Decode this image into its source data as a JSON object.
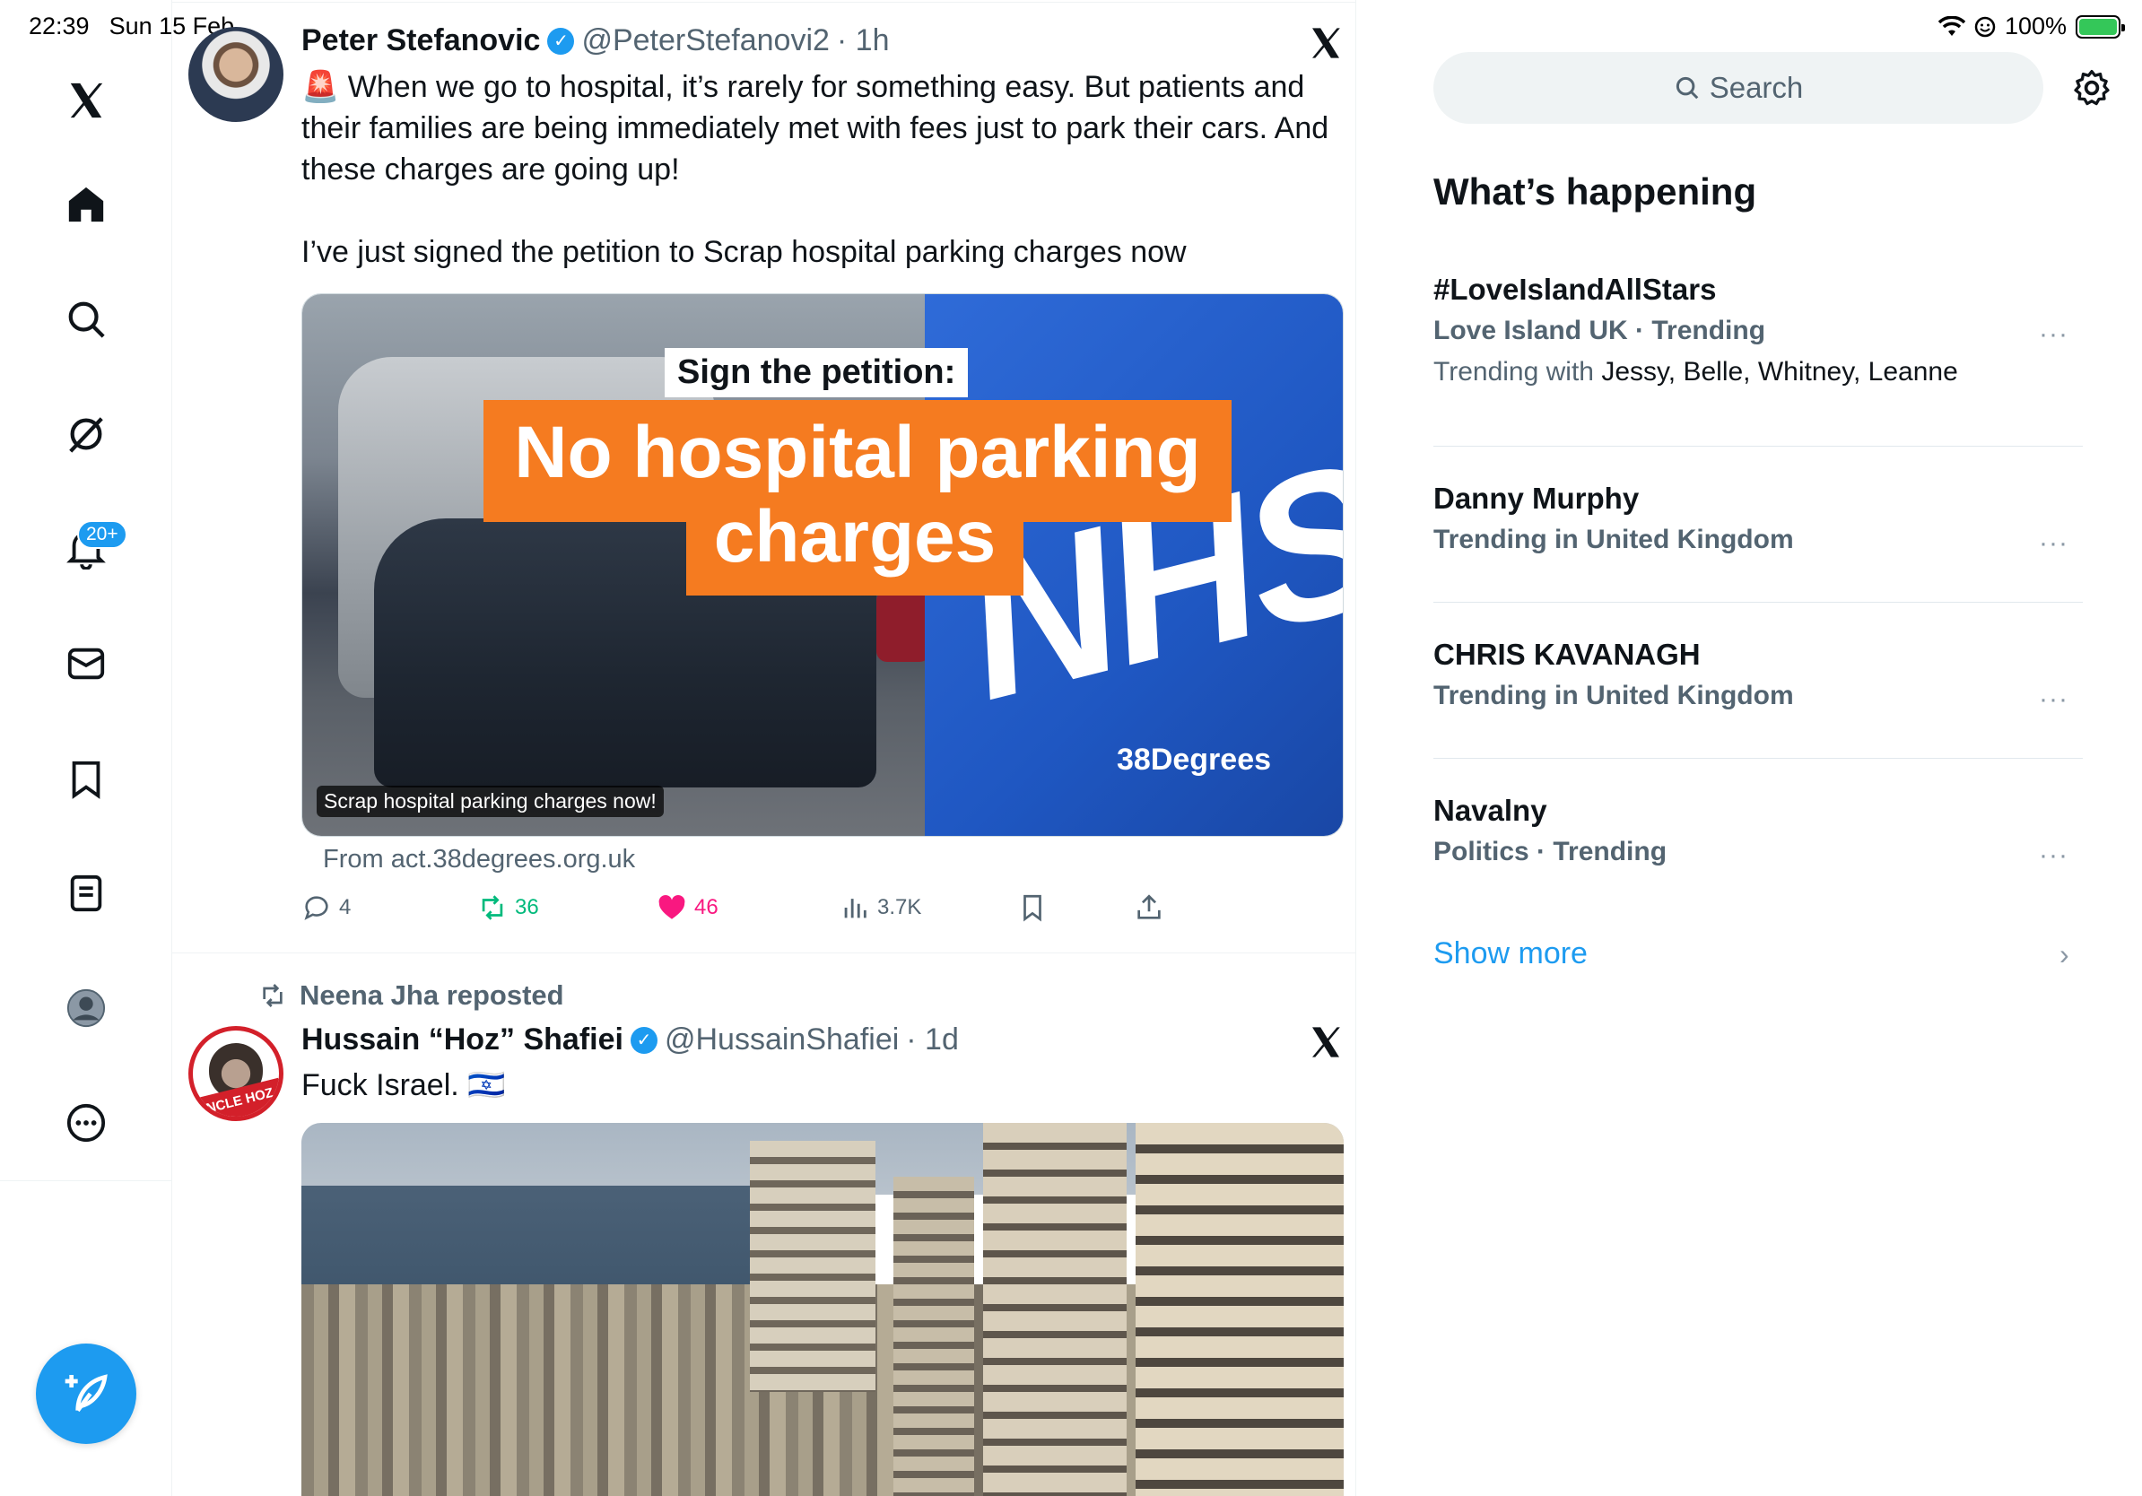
{
  "status_bar": {
    "time": "22:39",
    "date": "Sun 15 Feb",
    "battery": "100%"
  },
  "nav": {
    "items": [
      "x-logo",
      "home",
      "explore",
      "grok",
      "notifications",
      "messages",
      "bookmarks",
      "lists",
      "profile",
      "more"
    ],
    "notification_badge": "20+"
  },
  "tweet1": {
    "name": "Peter Stefanovic",
    "handle": "@PeterStefanovi2",
    "time": "· 1h",
    "text_line1": "🚨 When we go to hospital, it’s rarely for something easy. But patients and",
    "text_line2": "their families are being immediately met with fees just to park their cars. And",
    "text_line3": "these charges are going up!",
    "text_line4": "I’ve just signed the petition to Scrap hospital parking charges now",
    "media": {
      "sign_text": "Sign the petition:",
      "title_line1": "No hospital parking",
      "title_line2": "charges",
      "nhs": "NHS",
      "brand": "38Degrees",
      "caption": "Scrap hospital parking charges now!"
    },
    "link_from": "From act.38degrees.org.uk",
    "replies": "4",
    "reposts": "36",
    "likes": "46",
    "views": "3.7K"
  },
  "tweet2": {
    "reposted_by": "Neena Jha reposted",
    "name": "Hussain “Hoz” Shafiei",
    "handle": "@HussainShafiei",
    "time": "· 1d",
    "text": "Fuck Israel. 🇮🇱",
    "avatar_text": "UNCLE HOZ"
  },
  "sidebar": {
    "search_placeholder": "Search",
    "section_title": "What’s happening",
    "trends": [
      {
        "name": "#LoveIslandAllStars",
        "context": "Love Island UK · Trending",
        "with_label": "Trending with",
        "with": "Jessy, Belle, Whitney, Leanne"
      },
      {
        "name": "Danny Murphy",
        "context": "Trending in United Kingdom"
      },
      {
        "name": "CHRIS KAVANAGH",
        "context": "Trending in United Kingdom"
      },
      {
        "name": "Navalny",
        "context": "Politics · Trending"
      }
    ],
    "more_label": "···",
    "show_more": "Show more",
    "chevron": "›"
  },
  "colors": {
    "accent": "#1d9bf0",
    "repost_green": "#00ba7c",
    "like_pink": "#f91880",
    "text_secondary": "#536471"
  }
}
